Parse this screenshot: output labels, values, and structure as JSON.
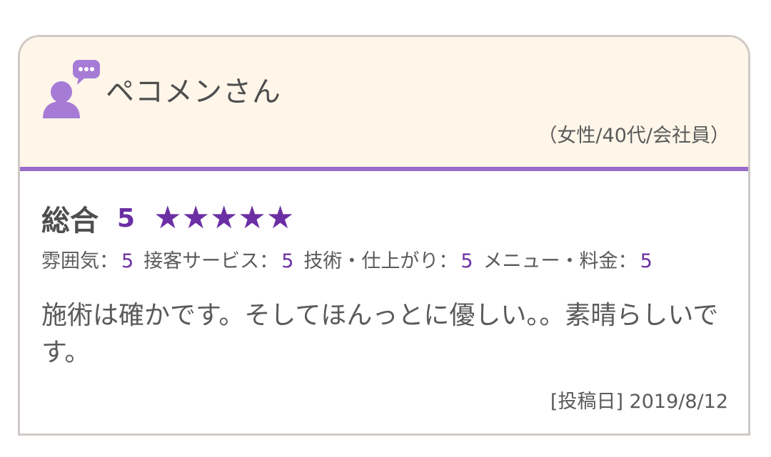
{
  "review": {
    "user": {
      "name": "ペコメンさん",
      "profile": "（女性/40代/会社員）"
    },
    "overall": {
      "label": "総合",
      "score": "5",
      "stars": 5,
      "star_glyph": "★"
    },
    "subscores": [
      {
        "label": "雰囲気：",
        "value": "5"
      },
      {
        "label": "接客サービス：",
        "value": "5"
      },
      {
        "label": "技術・仕上がり：",
        "value": "5"
      },
      {
        "label": "メニュー・料金：",
        "value": "5"
      }
    ],
    "comment": "施術は確かです。そしてほんっとに優しい。。素晴らしいです。",
    "date": "[投稿日] 2019/8/12"
  },
  "colors": {
    "accent": "#6b2fa3",
    "header_bg": "#fff6e9",
    "header_border": "#9a6bcb",
    "icon": "#a67bd6"
  },
  "icons": {
    "user": "user-speech-icon"
  }
}
